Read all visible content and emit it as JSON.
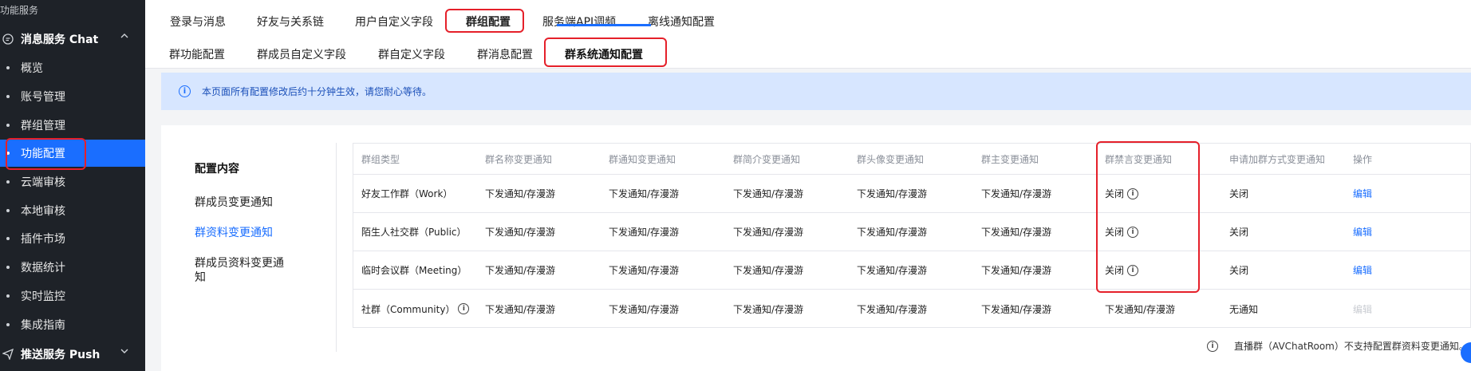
{
  "sidebar": {
    "section_label": "功能服务",
    "group_chat": {
      "label": "消息服务 Chat",
      "icon": "chat-bubble-icon"
    },
    "items": [
      {
        "label": "概览"
      },
      {
        "label": "账号管理"
      },
      {
        "label": "群组管理"
      },
      {
        "label": "功能配置",
        "active": true
      },
      {
        "label": "云端审核"
      },
      {
        "label": "本地审核"
      },
      {
        "label": "插件市场"
      },
      {
        "label": "数据统计"
      },
      {
        "label": "实时监控"
      },
      {
        "label": "集成指南"
      }
    ],
    "group_push": {
      "label": "推送服务 Push",
      "icon": "send-icon"
    }
  },
  "top_tabs": [
    "登录与消息",
    "好友与关系链",
    "用户自定义字段",
    "群组配置",
    "服务端API调频",
    "离线通知配置"
  ],
  "top_tab_active": "群组配置",
  "sub_tabs": [
    "群功能配置",
    "群成员自定义字段",
    "群自定义字段",
    "群消息配置",
    "群系统通知配置"
  ],
  "sub_tab_active": "群系统通知配置",
  "banner": {
    "text": "本页面所有配置修改后约十分钟生效，请您耐心等待。"
  },
  "config_panel": {
    "title": "配置内容",
    "items": [
      "群成员变更通知",
      "群资料变更通知",
      "群成员资料变更通知"
    ],
    "active": "群资料变更通知"
  },
  "table": {
    "headers": [
      "群组类型",
      "群名称变更通知",
      "群通知变更通知",
      "群简介变更通知",
      "群头像变更通知",
      "群主变更通知",
      "群禁言变更通知",
      "申请加群方式变更通知",
      "操作"
    ],
    "rows": [
      {
        "type": "好友工作群（Work）",
        "values": [
          "下发通知/存漫游",
          "下发通知/存漫游",
          "下发通知/存漫游",
          "下发通知/存漫游",
          "下发通知/存漫游",
          "关闭",
          "关闭"
        ],
        "action": "编辑"
      },
      {
        "type": "陌生人社交群（Public）",
        "values": [
          "下发通知/存漫游",
          "下发通知/存漫游",
          "下发通知/存漫游",
          "下发通知/存漫游",
          "下发通知/存漫游",
          "关闭",
          "关闭"
        ],
        "action": "编辑"
      },
      {
        "type": "临时会议群（Meeting）",
        "values": [
          "下发通知/存漫游",
          "下发通知/存漫游",
          "下发通知/存漫游",
          "下发通知/存漫游",
          "下发通知/存漫游",
          "关闭",
          "关闭"
        ],
        "action": "编辑"
      },
      {
        "type": "社群（Community）",
        "values": [
          "下发通知/存漫游",
          "下发通知/存漫游",
          "下发通知/存漫游",
          "下发通知/存漫游",
          "下发通知/存漫游",
          "下发通知/存漫游",
          "无通知"
        ],
        "action": "编辑"
      }
    ]
  },
  "footnote": "直播群（AVChatRoom）不支持配置群资料变更通知。",
  "colors": {
    "accent": "#1a6eff",
    "highlight": "#e5202a",
    "sidebar_bg": "#1e2228"
  }
}
